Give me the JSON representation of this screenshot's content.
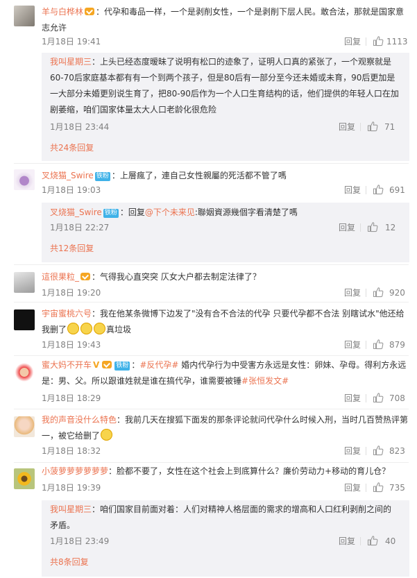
{
  "reply_label": "回复",
  "comments": [
    {
      "name": "羊与白桦林",
      "text": "：代孕和毒品一样，一个是剥削女性，一个是剥削下层人民。敢合法，那就是国家意志允许",
      "time": "1月18日 19:41",
      "likes": "1113",
      "sub": {
        "name": "我叫星期三",
        "text": "：上头已经态度暧昧了说明有松口的迹象了，证明人口真的紧张了，一个观察就是60-70后家庭基本都有有一个到两个孩子，但是80后有一部分至今还未婚或未育，90后更加是一大部分未婚更别说生育了，把80-90后作为一个人口生育结构的话，他们提供的年轻人口在加剧萎缩，咱们国家体量太大人口老龄化很危险",
        "time": "1月18日 23:44",
        "likes": "71"
      },
      "more": "共24条回复"
    },
    {
      "name": "叉烧猫_Swire",
      "badge": "铁粉",
      "text": "：上層瘋了，連自己女性親屬的死活都不管了嗎",
      "time": "1月18日 19:03",
      "likes": "691",
      "sub": {
        "name": "叉烧猫_Swire",
        "badge": "铁粉",
        "text_pre": "：回复",
        "mention": "@下个未来见",
        "text": ":聯姻資源幾個字看清楚了嗎",
        "time": "1月18日 22:27",
        "likes": "12"
      },
      "more": "共12条回复"
    },
    {
      "name": "這很果粒_",
      "text": "：气得我心直突突 仄女大户都去制定法律了？",
      "time": "1月18日 19:20",
      "likes": "920"
    },
    {
      "name": "宇宙蜜桃六号",
      "text": "：我在他某条微博下边发了\"没有合不合法的代孕 只要代孕都不合法 别瞎试水\"他还给我删了",
      "text_post": "真垃圾",
      "time": "1月18日 19:43",
      "likes": "879"
    },
    {
      "name": "蜜大妈不开车",
      "badge": "铁粉",
      "hashtag1": "#反代孕#",
      "text": " 婚内代孕行为中受害方永远是女性：卵妹、孕母。得利方永远是：男、父。所以跟谁姓就是谁在搞代孕，谁需要被锤",
      "hashtag2": "#张恒发文#",
      "time": "1月18日 18:29",
      "likes": "708"
    },
    {
      "name": "我的声音没什么特色",
      "text": "：我前几天在搜狐下面发的那条评论就问代孕什么时候入刑，当时几百赞热评第一，被它给删了",
      "time": "1月18日 18:32",
      "likes": "823"
    },
    {
      "name": "小菠萝萝萝萝萝萝",
      "text": "：脸都不要了，女性在这个社会上到底算什么？廉价劳动力+移动的育儿仓？",
      "time": "1月18日 19:39",
      "likes": "735",
      "sub": {
        "name": "我叫星期三",
        "text": "：咱们国家目前面对着：人们对精神人格层面的需求的增高和人口红利剥削之间的矛盾。",
        "time": "1月18日 23:49",
        "likes": "40"
      },
      "more": "共8条回复"
    }
  ]
}
